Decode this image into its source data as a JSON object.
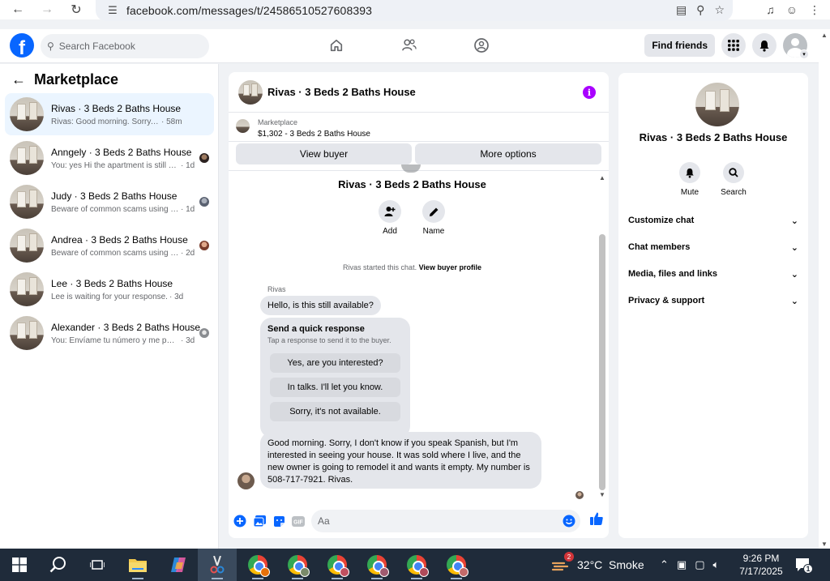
{
  "browser": {
    "url": "facebook.com/messages/t/24586510527608393"
  },
  "fb": {
    "search_placeholder": "Search Facebook",
    "find_friends": "Find friends"
  },
  "sidebar": {
    "title": "Marketplace",
    "conversations": [
      {
        "name": "Rivas · 3 Beds 2 Baths House",
        "preview": "Rivas: Good morning. Sorry, I don't know if you speak Spanish",
        "time": "· 58m",
        "active": true
      },
      {
        "name": "Anngely · 3 Beds 2 Baths House",
        "preview": "You: yes Hi the apartment is still available",
        "time": "· 1d"
      },
      {
        "name": "Judy · 3 Beds 2 Baths House",
        "preview": "Beware of common scams using payment apps",
        "time": "· 1d"
      },
      {
        "name": "Andrea · 3 Beds 2 Baths House",
        "preview": "Beware of common scams using payment apps",
        "time": "· 2d"
      },
      {
        "name": "Lee · 3 Beds 2 Baths House",
        "preview": "Lee is waiting for your response.",
        "time": "· 3d"
      },
      {
        "name": "Alexander · 3 Beds 2 Baths House",
        "preview": "You: Envíame tu número y me pondré en contacto",
        "time": "· 3d"
      }
    ]
  },
  "chat": {
    "title": "Rivas · 3 Beds 2 Baths House",
    "marketplace_label": "Marketplace",
    "listing": "$1,302 - 3 Beds 2 Baths House",
    "view_buyer": "View buyer",
    "more_options": "More options",
    "intro_name": "Rivas · 3 Beds 2 Baths House",
    "add_label": "Add",
    "name_label": "Name",
    "started_text": "Rivas started this chat.",
    "view_profile": "View buyer profile",
    "sender": "Rivas",
    "msg1": "Hello, is this still available?",
    "quick_title": "Send a quick response",
    "quick_sub": "Tap a response to send it to the buyer.",
    "quick_opts": [
      "Yes, are you interested?",
      "In talks. I'll let you know.",
      "Sorry, it's not available."
    ],
    "msg2": "Good morning. Sorry, I don't know if you speak Spanish, but I'm interested in seeing your house. It was sold where I live, and the new owner is going to remodel it and wants it empty. My number is 508-717-7921. Rivas.",
    "composer_placeholder": "Aa"
  },
  "panel": {
    "name": "Rivas · 3 Beds 2 Baths House",
    "mute": "Mute",
    "search": "Search",
    "sections": [
      "Customize chat",
      "Chat members",
      "Media, files and links",
      "Privacy & support"
    ]
  },
  "taskbar": {
    "weather_badge": "2",
    "weather": "32°C  Smoke",
    "time": "9:26 PM",
    "date": "7/17/2025",
    "notif_count": "1"
  }
}
